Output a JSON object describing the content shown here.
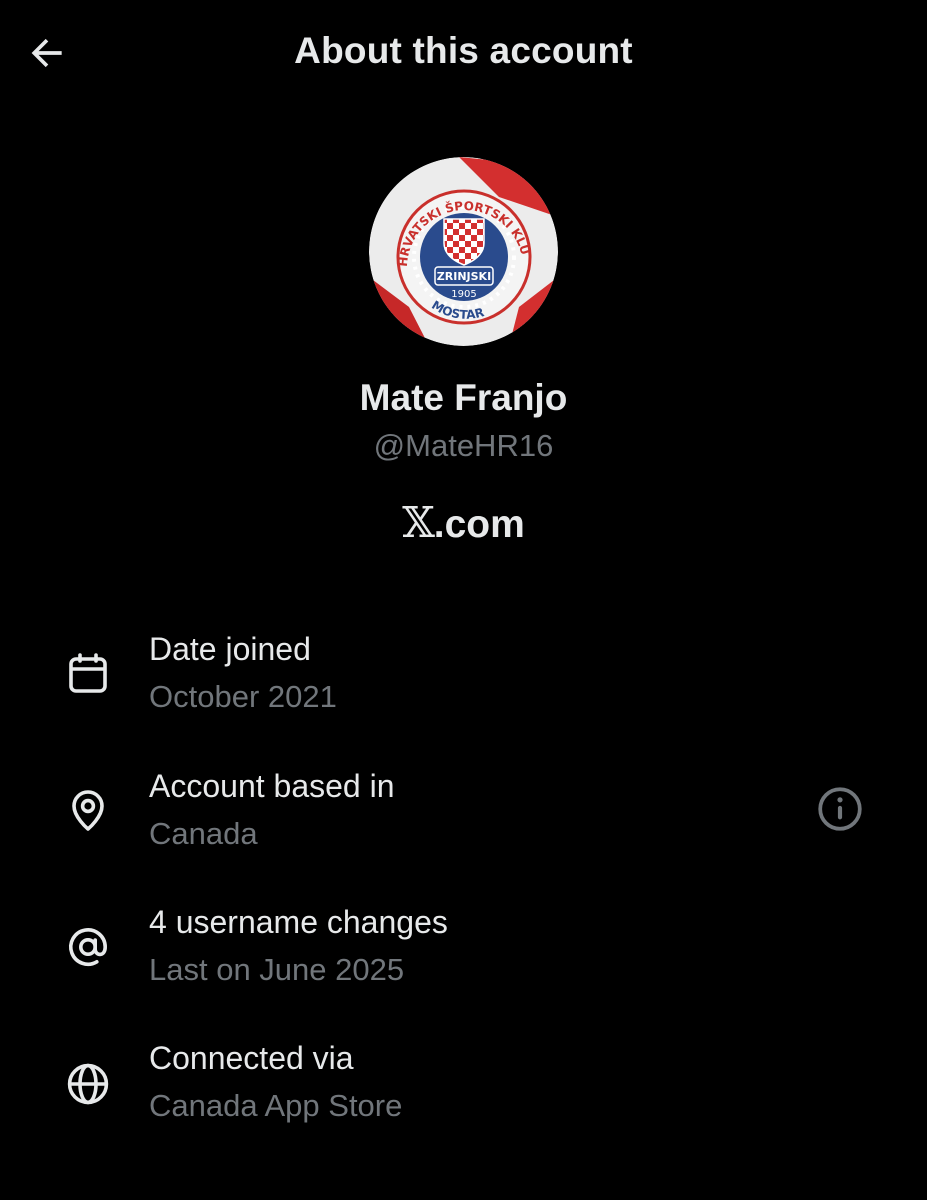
{
  "header": {
    "title": "About this account",
    "back_icon": "arrow-left-icon"
  },
  "profile": {
    "display_name": "Mate Franjo",
    "handle": "@MateHR16",
    "platform_x": "𝕏",
    "platform_rest": ".com",
    "avatar_text": {
      "ring_top": "HRVATSKI ŠPORTSKI KLUB",
      "ring_bottom": "MOSTAR",
      "center": "ZRINJSKI",
      "year": "1905"
    }
  },
  "details": [
    {
      "icon": "calendar-icon",
      "label": "Date joined",
      "value": "October 2021"
    },
    {
      "icon": "location-pin-icon",
      "label": "Account based in",
      "value": "Canada",
      "help_icon": "info-circle-icon"
    },
    {
      "icon": "at-sign-icon",
      "label": "4 username changes",
      "value": "Last on June 2025"
    },
    {
      "icon": "globe-icon",
      "label": "Connected via",
      "value": "Canada App Store"
    }
  ],
  "colors": {
    "background": "#000000",
    "primary_text": "#e7e9ea",
    "secondary_text": "#71767b",
    "crest_red": "#d32f2f",
    "crest_blue": "#2a4b8d"
  }
}
